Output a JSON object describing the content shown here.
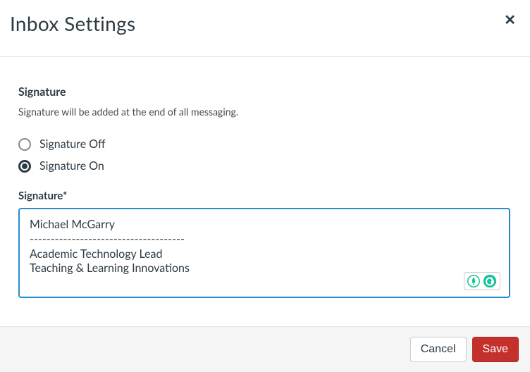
{
  "header": {
    "title": "Inbox Settings"
  },
  "signature_section": {
    "title": "Signature",
    "description": "Signature will be added at the end of all messaging.",
    "radio_off_label": "Signature Off",
    "radio_on_label": "Signature On",
    "selected": "on",
    "field_label": "Signature*",
    "value": "Michael McGarry\n-------------------------------------\nAcademic Technology Lead\nTeaching & Learning Innovations"
  },
  "footer": {
    "cancel_label": "Cancel",
    "save_label": "Save"
  },
  "icons": {
    "close": "✕",
    "assistant_badge": "assistant-badge-icon",
    "grammarly_badge": "grammarly-badge-icon"
  },
  "colors": {
    "accent": "#268ccc",
    "danger": "#c4302b",
    "text": "#2d3b45",
    "footer_bg": "#f5f5f5",
    "grammarly_green": "#15C39A"
  }
}
